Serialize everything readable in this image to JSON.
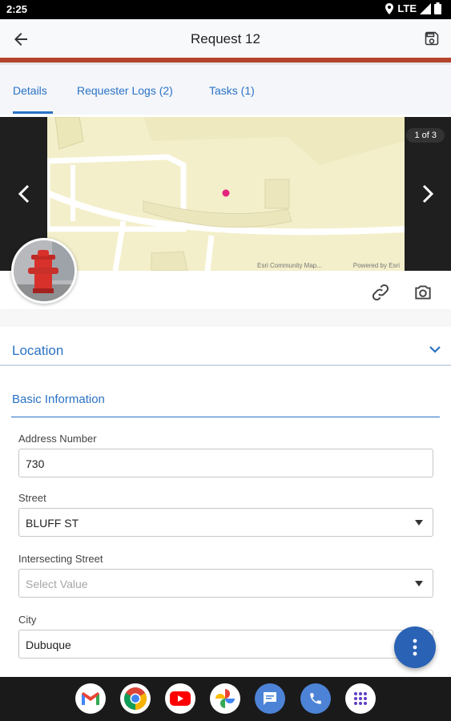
{
  "status_bar": {
    "time": "2:25",
    "network": "LTE"
  },
  "app_bar": {
    "title": "Request 12"
  },
  "tabs": [
    {
      "label": "Details",
      "active": true
    },
    {
      "label": "Requester Logs (2)",
      "active": false
    },
    {
      "label": "Tasks (1)",
      "active": false
    }
  ],
  "gallery": {
    "counter": "1 of 3",
    "map_attribution_left": "Esri Community Map...",
    "map_attribution_right": "Powered by Esri"
  },
  "sections": {
    "location": "Location",
    "basic_information": "Basic Information"
  },
  "fields": {
    "address_number": {
      "label": "Address Number",
      "value": "730"
    },
    "street": {
      "label": "Street",
      "value": "BLUFF ST"
    },
    "intersecting_street": {
      "label": "Intersecting Street",
      "placeholder": "Select Value"
    },
    "city": {
      "label": "City",
      "value": "Dubuque"
    }
  },
  "colors": {
    "accent": "#2a72c5",
    "header_stripe": "#b5432d",
    "fab": "#2a62b5",
    "map_background": "#f3efca"
  },
  "dock_apps": [
    "gmail-icon",
    "chrome-icon",
    "youtube-icon",
    "photos-icon",
    "messages-icon",
    "phone-icon",
    "app-drawer-icon"
  ]
}
